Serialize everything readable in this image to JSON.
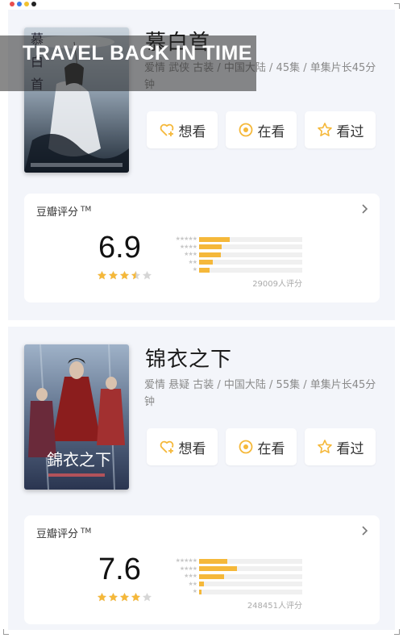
{
  "colors": {
    "accent": "#f5b83a",
    "panel_bg": "#f3f5fa",
    "card_bg": "#ffffff",
    "meta_text": "#8a8a8a",
    "dots": [
      "#e84d4d",
      "#3c7be8",
      "#f2c230",
      "#222222"
    ]
  },
  "overlay": {
    "text": "TRAVEL BACK IN TIME"
  },
  "shows": [
    {
      "title": "慕白首",
      "meta": "爱情 武侠 古装 / 中国大陆 / 45集 / 单集片长45分钟",
      "poster_theme": "misty blue-grey swordsman poster with umbrella",
      "buttons": [
        {
          "label": "想看",
          "icon": "heart-plus-icon"
        },
        {
          "label": "在看",
          "icon": "circle-dot-icon"
        },
        {
          "label": "看过",
          "icon": "star-outline-icon"
        }
      ],
      "rating": {
        "label": "豆瓣评分",
        "tm": "TM",
        "score": "6.9",
        "stars_value": 3.5,
        "votes": "29009人评分",
        "distribution": [
          0.3,
          0.22,
          0.21,
          0.13,
          0.1
        ]
      }
    },
    {
      "title": "锦衣之下",
      "meta": "爱情 悬疑 古装 / 中国大陆 / 55集 / 单集片长45分钟",
      "poster_theme": "red-robed guards in snowy forest poster",
      "buttons": [
        {
          "label": "想看",
          "icon": "heart-plus-icon"
        },
        {
          "label": "在看",
          "icon": "circle-dot-icon"
        },
        {
          "label": "看过",
          "icon": "star-outline-icon"
        }
      ],
      "rating": {
        "label": "豆瓣评分",
        "tm": "TM",
        "score": "7.6",
        "stars_value": 4,
        "votes": "248451人评分",
        "distribution": [
          0.27,
          0.37,
          0.24,
          0.05,
          0.02
        ]
      }
    }
  ]
}
